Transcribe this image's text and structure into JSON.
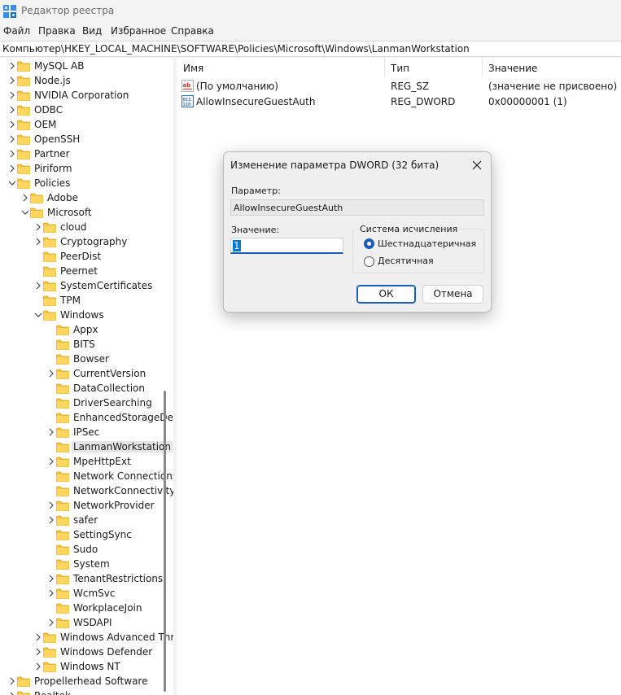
{
  "window": {
    "title": "Редактор реестра"
  },
  "menu": [
    "Файл",
    "Правка",
    "Вид",
    "Избранное",
    "Справка"
  ],
  "address": "Компьютер\\HKEY_LOCAL_MACHINE\\SOFTWARE\\Policies\\Microsoft\\Windows\\LanmanWorkstation",
  "tree": [
    {
      "label": "MySQL AB",
      "depth": 0,
      "expander": "collapsed"
    },
    {
      "label": "Node.js",
      "depth": 0,
      "expander": "collapsed"
    },
    {
      "label": "NVIDIA Corporation",
      "depth": 0,
      "expander": "collapsed"
    },
    {
      "label": "ODBC",
      "depth": 0,
      "expander": "collapsed"
    },
    {
      "label": "OEM",
      "depth": 0,
      "expander": "collapsed"
    },
    {
      "label": "OpenSSH",
      "depth": 0,
      "expander": "collapsed"
    },
    {
      "label": "Partner",
      "depth": 0,
      "expander": "collapsed"
    },
    {
      "label": "Piriform",
      "depth": 0,
      "expander": "collapsed"
    },
    {
      "label": "Policies",
      "depth": 0,
      "expander": "expanded"
    },
    {
      "label": "Adobe",
      "depth": 1,
      "expander": "collapsed"
    },
    {
      "label": "Microsoft",
      "depth": 1,
      "expander": "expanded"
    },
    {
      "label": "cloud",
      "depth": 2,
      "expander": "collapsed"
    },
    {
      "label": "Cryptography",
      "depth": 2,
      "expander": "collapsed"
    },
    {
      "label": "PeerDist",
      "depth": 2,
      "expander": "none"
    },
    {
      "label": "Peernet",
      "depth": 2,
      "expander": "none"
    },
    {
      "label": "SystemCertificates",
      "depth": 2,
      "expander": "collapsed"
    },
    {
      "label": "TPM",
      "depth": 2,
      "expander": "none"
    },
    {
      "label": "Windows",
      "depth": 2,
      "expander": "expanded"
    },
    {
      "label": "Appx",
      "depth": 3,
      "expander": "none"
    },
    {
      "label": "BITS",
      "depth": 3,
      "expander": "none"
    },
    {
      "label": "Bowser",
      "depth": 3,
      "expander": "none"
    },
    {
      "label": "CurrentVersion",
      "depth": 3,
      "expander": "collapsed"
    },
    {
      "label": "DataCollection",
      "depth": 3,
      "expander": "none"
    },
    {
      "label": "DriverSearching",
      "depth": 3,
      "expander": "none"
    },
    {
      "label": "EnhancedStorageDevi",
      "depth": 3,
      "expander": "none"
    },
    {
      "label": "IPSec",
      "depth": 3,
      "expander": "collapsed"
    },
    {
      "label": "LanmanWorkstation",
      "depth": 3,
      "expander": "none",
      "selected": true
    },
    {
      "label": "MpeHttpExt",
      "depth": 3,
      "expander": "collapsed"
    },
    {
      "label": "Network Connections",
      "depth": 3,
      "expander": "none"
    },
    {
      "label": "NetworkConnectivityS",
      "depth": 3,
      "expander": "none"
    },
    {
      "label": "NetworkProvider",
      "depth": 3,
      "expander": "collapsed"
    },
    {
      "label": "safer",
      "depth": 3,
      "expander": "collapsed"
    },
    {
      "label": "SettingSync",
      "depth": 3,
      "expander": "none"
    },
    {
      "label": "Sudo",
      "depth": 3,
      "expander": "none"
    },
    {
      "label": "System",
      "depth": 3,
      "expander": "none"
    },
    {
      "label": "TenantRestrictions",
      "depth": 3,
      "expander": "collapsed"
    },
    {
      "label": "WcmSvc",
      "depth": 3,
      "expander": "collapsed"
    },
    {
      "label": "WorkplaceJoin",
      "depth": 3,
      "expander": "none"
    },
    {
      "label": "WSDAPI",
      "depth": 3,
      "expander": "collapsed"
    },
    {
      "label": "Windows Advanced Thre",
      "depth": 2,
      "expander": "collapsed"
    },
    {
      "label": "Windows Defender",
      "depth": 2,
      "expander": "collapsed"
    },
    {
      "label": "Windows NT",
      "depth": 2,
      "expander": "collapsed"
    },
    {
      "label": "Propellerhead Software",
      "depth": 0,
      "expander": "collapsed"
    },
    {
      "label": "Realtek",
      "depth": 0,
      "expander": "collapsed"
    }
  ],
  "values_pane": {
    "columns": {
      "name": "Имя",
      "type": "Тип",
      "value": "Значение"
    },
    "rows": [
      {
        "name": "(По умолчанию)",
        "type": "REG_SZ",
        "value": "(значение не присвоено)",
        "icon": "string-value-icon"
      },
      {
        "name": "AllowInsecureGuestAuth",
        "type": "REG_DWORD",
        "value": "0x00000001 (1)",
        "icon": "binary-value-icon"
      }
    ]
  },
  "dialog": {
    "title": "Изменение параметра DWORD (32 бита)",
    "param_label": "Параметр:",
    "param_value": "AllowInsecureGuestAuth",
    "value_label": "Значение:",
    "value_data": "1",
    "radix_label": "Система исчисления",
    "radix_options": [
      "Шестнадцатеричная",
      "Десятичная"
    ],
    "radix_selected": "Шестнадцатеричная",
    "ok_label": "ОК",
    "cancel_label": "Отмена"
  },
  "colors": {
    "accent": "#1a5fb4",
    "selection": "#0078d4",
    "folder": "#f4c542"
  }
}
